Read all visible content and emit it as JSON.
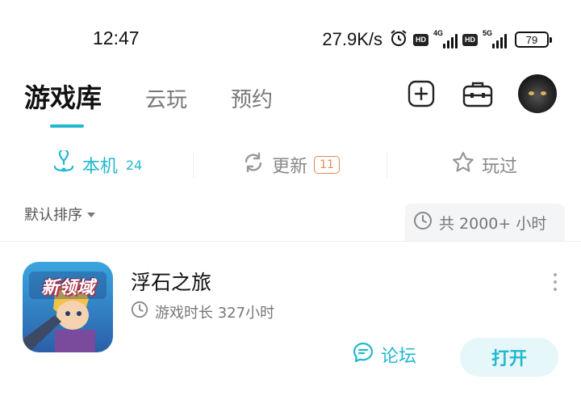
{
  "status_bar": {
    "time": "12:47",
    "net_speed": "27.9K/s",
    "hd_label": "HD",
    "sim1_gen": "4G",
    "sim2_gen": "5G",
    "battery": "79"
  },
  "top_tabs": [
    {
      "label": "游戏库",
      "active": true
    },
    {
      "label": "云玩",
      "active": false
    },
    {
      "label": "预约",
      "active": false
    }
  ],
  "header_icons": [
    "add-icon",
    "toolbox-icon",
    "avatar"
  ],
  "sub_tabs": {
    "local": {
      "label": "本机",
      "count": "24",
      "icon": "download-icon"
    },
    "update": {
      "label": "更新",
      "badge": "11",
      "icon": "refresh-icon"
    },
    "played": {
      "label": "玩过",
      "icon": "star-icon"
    }
  },
  "sort": {
    "label": "默认排序"
  },
  "total_playtime": "共 2000+ 小时",
  "games": [
    {
      "title": "浮石之旅",
      "icon_text": "新领域",
      "playtime": "游戏时长 327小时",
      "forum_label": "论坛",
      "open_label": "打开"
    }
  ],
  "colors": {
    "accent": "#22b8cf",
    "badge": "#e2895a",
    "open_bg": "#e6f7f9"
  }
}
